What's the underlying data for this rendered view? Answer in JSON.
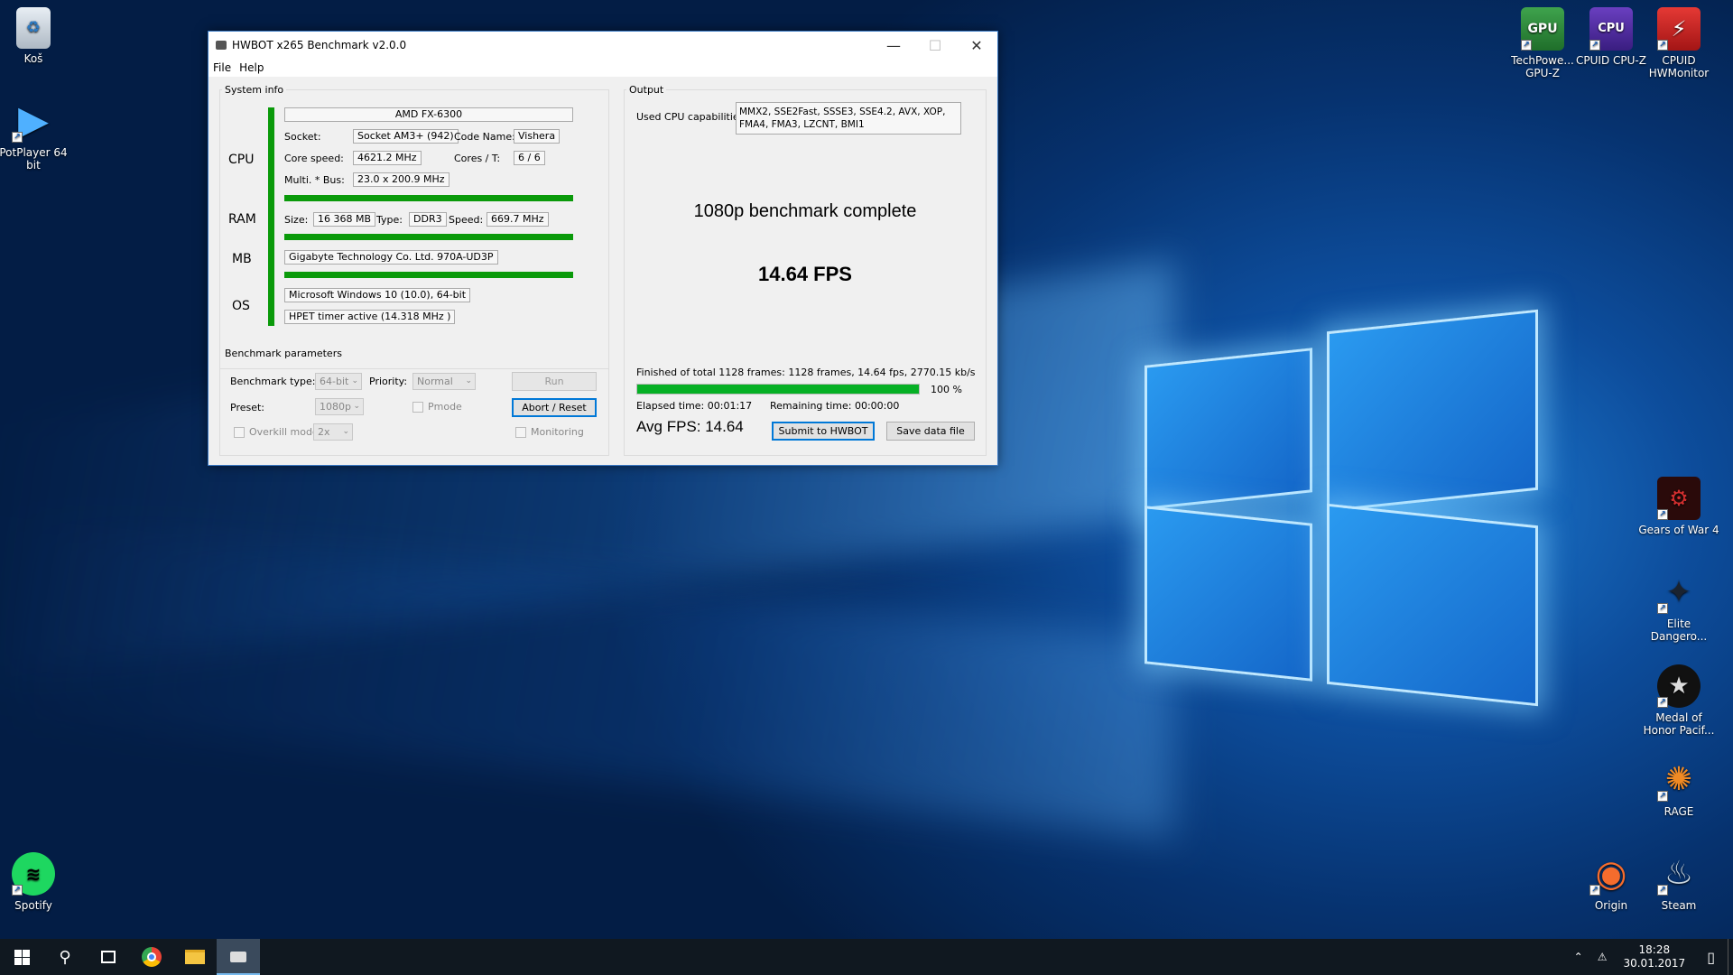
{
  "desktop": {
    "icons_left": [
      {
        "label": "Koš",
        "icon": "recycle-bin-icon"
      },
      {
        "label": "PotPlayer 64 bit",
        "icon": "potplayer-icon"
      },
      {
        "label": "Spotify",
        "icon": "spotify-icon"
      }
    ],
    "icons_top_right": [
      {
        "label": "TechPowe... GPU-Z",
        "icon": "gpuz-icon"
      },
      {
        "label": "CPUID CPU-Z",
        "icon": "cpuz-icon"
      },
      {
        "label": "CPUID HWMonitor",
        "icon": "hwmonitor-icon"
      }
    ],
    "icons_right": [
      {
        "label": "Gears of War 4",
        "icon": "gears-of-war-icon"
      },
      {
        "label": "Elite Dangero...",
        "icon": "elite-dangerous-icon"
      },
      {
        "label": "Medal of Honor Pacif...",
        "icon": "medal-of-honor-icon"
      },
      {
        "label": "RAGE",
        "icon": "rage-icon"
      },
      {
        "label": "Origin",
        "icon": "origin-icon"
      },
      {
        "label": "Steam",
        "icon": "steam-icon"
      }
    ]
  },
  "window": {
    "title": "HWBOT x265 Benchmark v2.0.0",
    "menu": [
      "File",
      "Help"
    ],
    "system_info": {
      "group_label": "System info",
      "cpu_label": "CPU",
      "ram_label": "RAM",
      "mb_label": "MB",
      "os_label": "OS",
      "cpu_name": "AMD FX-6300",
      "socket_label": "Socket:",
      "socket_value": "Socket AM3+ (942)",
      "codename_label": "Code Name:",
      "codename_value": "Vishera",
      "corespeed_label": "Core speed:",
      "corespeed_value": "4621.2 MHz",
      "cores_label": "Cores / T:",
      "cores_value": "6 / 6",
      "multi_label": "Multi. * Bus:",
      "multi_value": "23.0 x 200.9 MHz",
      "size_label": "Size:",
      "size_value": "16 368 MB",
      "type_label": "Type:",
      "type_value": "DDR3",
      "speed_label": "Speed:",
      "speed_value": "669.7 MHz",
      "mb_value": "Gigabyte Technology Co. Ltd. 970A-UD3P",
      "os_value": "Microsoft Windows 10 (10.0), 64-bit",
      "timer_value": "HPET timer active (14.318 MHz )"
    },
    "params": {
      "group_label": "Benchmark parameters",
      "bench_type_label": "Benchmark type:",
      "bench_type_value": "64-bit",
      "priority_label": "Priority:",
      "priority_value": "Normal",
      "preset_label": "Preset:",
      "preset_value": "1080p",
      "pmode_label": "Pmode",
      "overkill_label": "Overkill mode",
      "overkill_value": "2x",
      "monitoring_label": "Monitoring",
      "run_label": "Run",
      "abort_label": "Abort / Reset"
    },
    "output": {
      "group_label": "Output",
      "cpu_caps_label": "Used CPU capabilities:",
      "cpu_caps_value": "MMX2, SSE2Fast, SSSE3, SSE4.2, AVX, XOP, FMA4, FMA3, LZCNT, BMI1",
      "status": "1080p benchmark complete",
      "fps": "14.64 FPS",
      "frames_line": "Finished of total 1128 frames: 1128 frames, 14.64 fps,  2770.15 kb/s",
      "progress_percent": 100,
      "progress_label": "100 %",
      "elapsed": "Elapsed time: 00:01:17",
      "remaining": "Remaining time: 00:00:00",
      "avg_fps": "Avg FPS: 14.64",
      "submit_label": "Submit to HWBOT",
      "save_label": "Save data file"
    }
  },
  "taskbar": {
    "time": "18:28",
    "date": "30.01.2017"
  }
}
